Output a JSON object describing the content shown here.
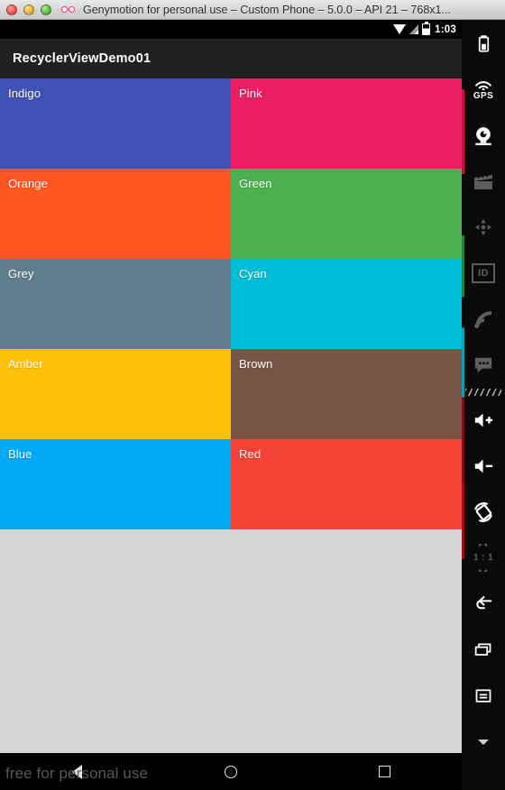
{
  "window": {
    "title": "Genymotion for personal use – Custom Phone – 5.0.0 – API 21 – 768x1...",
    "controls": {
      "close": "close",
      "minimize": "minimize",
      "zoom": "zoom"
    },
    "logo_name": "genymotion-logo"
  },
  "status_bar": {
    "time": "1:03",
    "icons": [
      "wifi-icon",
      "signal-icon",
      "battery-icon"
    ]
  },
  "app": {
    "title": "RecyclerViewDemo01"
  },
  "grid": {
    "items": [
      {
        "label": "Indigo",
        "color": "#3F51B5"
      },
      {
        "label": "Pink",
        "color": "#E91E63"
      },
      {
        "label": "Orange",
        "color": "#FF5722"
      },
      {
        "label": "Green",
        "color": "#4CAF50"
      },
      {
        "label": "Grey",
        "color": "#607D8B"
      },
      {
        "label": "Cyan",
        "color": "#00BCD4"
      },
      {
        "label": "Amber",
        "color": "#FFC107"
      },
      {
        "label": "Brown",
        "color": "#795548"
      },
      {
        "label": "Blue",
        "color": "#03A9F4"
      },
      {
        "label": "Red",
        "color": "#F44336"
      }
    ],
    "background": "#D5D5D5"
  },
  "nav_bar": {
    "back": "back-button",
    "home": "home-button",
    "recents": "recents-button"
  },
  "watermark": {
    "text": "free for personal use"
  },
  "toolbar": {
    "items": [
      {
        "name": "battery-widget",
        "glyph": "battery",
        "enabled": true
      },
      {
        "name": "gps-widget",
        "glyph": "gps",
        "enabled": true,
        "label": "GPS"
      },
      {
        "name": "camera-widget",
        "glyph": "camera",
        "enabled": true
      },
      {
        "name": "video-widget",
        "glyph": "clapper",
        "enabled": false
      },
      {
        "name": "dpad-widget",
        "glyph": "dpad",
        "enabled": false
      },
      {
        "name": "identifiers-widget",
        "glyph": "id",
        "enabled": false,
        "label": "ID"
      },
      {
        "name": "network-widget",
        "glyph": "network",
        "enabled": false
      },
      {
        "name": "sms-widget",
        "glyph": "sms",
        "enabled": false
      },
      {
        "name": "volume-up-button",
        "glyph": "volume-up",
        "enabled": true
      },
      {
        "name": "volume-down-button",
        "glyph": "volume-down",
        "enabled": true
      },
      {
        "name": "rotate-button",
        "glyph": "rotate",
        "enabled": true
      },
      {
        "name": "actual-size-button",
        "glyph": "one-to-one",
        "enabled": false,
        "label": "1 : 1"
      },
      {
        "name": "android-back-button",
        "glyph": "back",
        "enabled": true
      },
      {
        "name": "android-recents-button",
        "glyph": "recents",
        "enabled": true
      },
      {
        "name": "android-menu-button",
        "glyph": "menu",
        "enabled": true
      },
      {
        "name": "more-button",
        "glyph": "chevron-down",
        "enabled": true
      }
    ]
  }
}
